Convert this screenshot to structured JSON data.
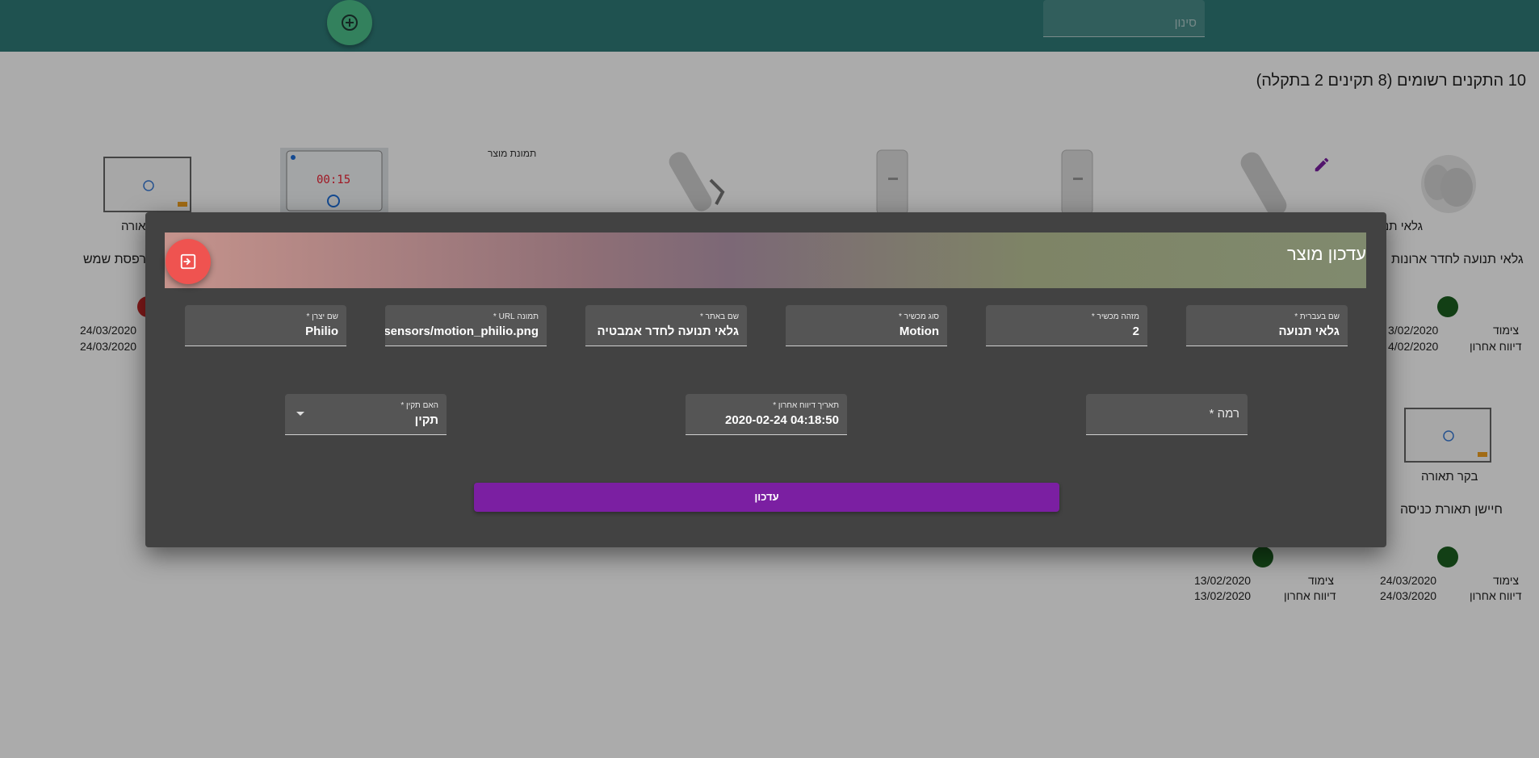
{
  "topbar": {
    "filter_placeholder": "סינון",
    "add_icon": "plus-circle-icon"
  },
  "summary": "10 התקנים רשומים (8 תקינים 2 בתקלה)",
  "devices_row1": [
    {
      "name": "גלאי תנועה",
      "description": "גלאי תנועה לחדר ארונות",
      "paired_label": "צימוד",
      "last_report_label": "דיווח אחרון",
      "paired_date": "3/02/2020",
      "last_report_date": "4/02/2020",
      "status_color": "#1b5e20"
    },
    {
      "name": "אורה",
      "description": "מרפסת שמש",
      "paired_date": "24/03/2020",
      "last_report_date": "24/03/2020",
      "status_color": "#c62828"
    }
  ],
  "broken_image_alt": "תמונת מוצר",
  "devices_row2": [
    {
      "name": "בקר תאורה",
      "description": "חיישן תאורת כניסה",
      "paired_label": "צימוד",
      "last_report_label": "דיווח אחרון",
      "paired_date": "24/03/2020",
      "last_report_date": "24/03/2020",
      "status_color": "#1b5e20"
    },
    {
      "paired_label": "צימוד",
      "last_report_label": "דיווח אחרון",
      "paired_date": "13/02/2020",
      "last_report_date": "13/02/2020",
      "status_color": "#1b5e20"
    }
  ],
  "dialog": {
    "title": "עדכון מוצר",
    "close_icon": "exit-icon",
    "fields": {
      "hebrew_name": {
        "label": "שם בעברית *",
        "value": "גלאי תנועה"
      },
      "device_id": {
        "label": "מזהה מכשיר *",
        "value": "2"
      },
      "device_type": {
        "label": "סוג מכשיר *",
        "value": "Motion"
      },
      "site_name": {
        "label": "שם באתר *",
        "value": "גלאי תנועה לחדר אמבטיה"
      },
      "image_url": {
        "label": "תמונה URL *",
        "value": "s/sensors/motion_philio.png"
      },
      "manufacturer": {
        "label": "שם יצרן *",
        "value": "Philio"
      },
      "level": {
        "placeholder": "רמה *"
      },
      "last_report": {
        "label": "תאריך דיווח אחרון *",
        "value": "2020-02-24 04:18:50"
      },
      "is_valid": {
        "label": "האם תקין *",
        "value": "תקין"
      }
    },
    "submit_label": "עדכון"
  },
  "colors": {
    "topbar": "#2f7b78",
    "add_button": "#4cc08b",
    "dialog_bg": "#424242",
    "close_fab": "#ef5350",
    "submit": "#7b1fa2"
  }
}
